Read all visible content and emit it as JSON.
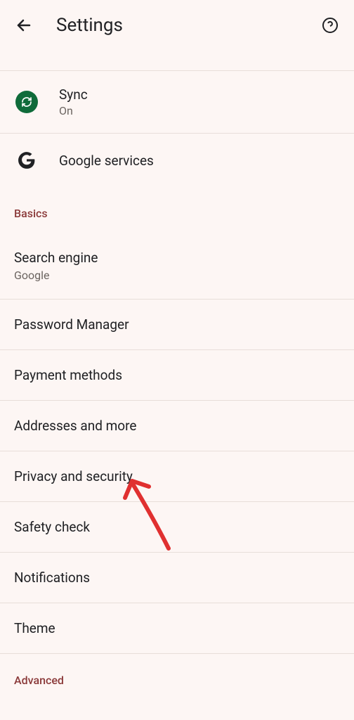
{
  "header": {
    "title": "Settings"
  },
  "sync": {
    "label": "Sync",
    "status": "On"
  },
  "google_services": {
    "label": "Google services"
  },
  "sections": {
    "basics": "Basics",
    "advanced": "Advanced"
  },
  "basics_items": {
    "search_engine": {
      "label": "Search engine",
      "value": "Google"
    },
    "password_manager": {
      "label": "Password Manager"
    },
    "payment_methods": {
      "label": "Payment methods"
    },
    "addresses": {
      "label": "Addresses and more"
    },
    "privacy": {
      "label": "Privacy and security"
    },
    "safety_check": {
      "label": "Safety check"
    },
    "notifications": {
      "label": "Notifications"
    },
    "theme": {
      "label": "Theme"
    }
  }
}
